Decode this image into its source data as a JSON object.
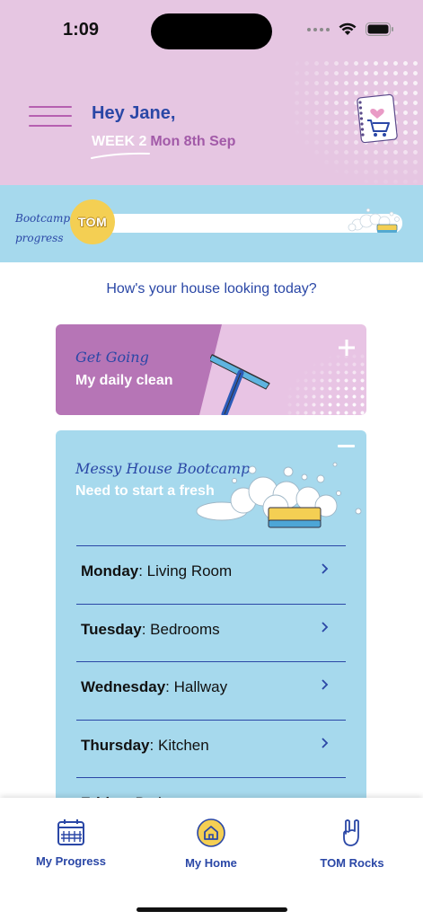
{
  "status_bar": {
    "time": "1:09"
  },
  "header": {
    "greeting": "Hey Jane,",
    "week": "WEEK 2",
    "date": "Mon 8th Sep"
  },
  "progress": {
    "label_line1": "Bootcamp",
    "label_line2": "progress",
    "badge": "TOM"
  },
  "question": "How's your house looking today?",
  "cards": {
    "get_going": {
      "title": "Get Going",
      "subtitle": "My daily clean"
    },
    "bootcamp": {
      "title": "Messy House Bootcamp",
      "subtitle": "Need to start a fresh",
      "days": [
        {
          "day": "Monday",
          "room": ": Living Room"
        },
        {
          "day": "Tuesday",
          "room": ": Bedrooms"
        },
        {
          "day": "Wednesday",
          "room": ": Hallway"
        },
        {
          "day": "Thursday",
          "room": ": Kitchen"
        },
        {
          "day": "Friday",
          "room": ": Bathroom"
        }
      ]
    }
  },
  "tabs": [
    {
      "label": "My Progress"
    },
    {
      "label": "My Home"
    },
    {
      "label": "TOM Rocks"
    }
  ],
  "colors": {
    "header_bg": "#e6c6e2",
    "accent_blue": "#2a47a6",
    "band_blue": "#a6d9ed",
    "purple": "#b675b6",
    "yellow": "#f4cf53"
  }
}
